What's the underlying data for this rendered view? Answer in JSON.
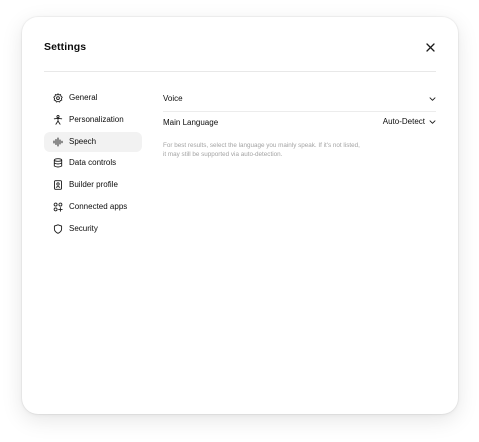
{
  "settings": {
    "title": "Settings"
  },
  "sidebar": {
    "items": [
      {
        "label": "General",
        "icon": "gear-icon"
      },
      {
        "label": "Personalization",
        "icon": "person-icon"
      },
      {
        "label": "Speech",
        "icon": "waveform-icon",
        "active": true
      },
      {
        "label": "Data controls",
        "icon": "database-icon"
      },
      {
        "label": "Builder profile",
        "icon": "id-badge-icon"
      },
      {
        "label": "Connected apps",
        "icon": "apps-grid-icon"
      },
      {
        "label": "Security",
        "icon": "shield-icon"
      }
    ]
  },
  "speech": {
    "voice_label": "Voice",
    "main_language_label": "Main Language",
    "main_language_value": "Auto-Detect",
    "hint_line1": "For best results, select the language you mainly speak. If it's not listed,",
    "hint_line2": "it may still be supported via auto-detection."
  },
  "colors": {
    "active_background": "#f2f2f2",
    "divider": "#e8e8e8",
    "hint_text": "#a3a3a3"
  }
}
